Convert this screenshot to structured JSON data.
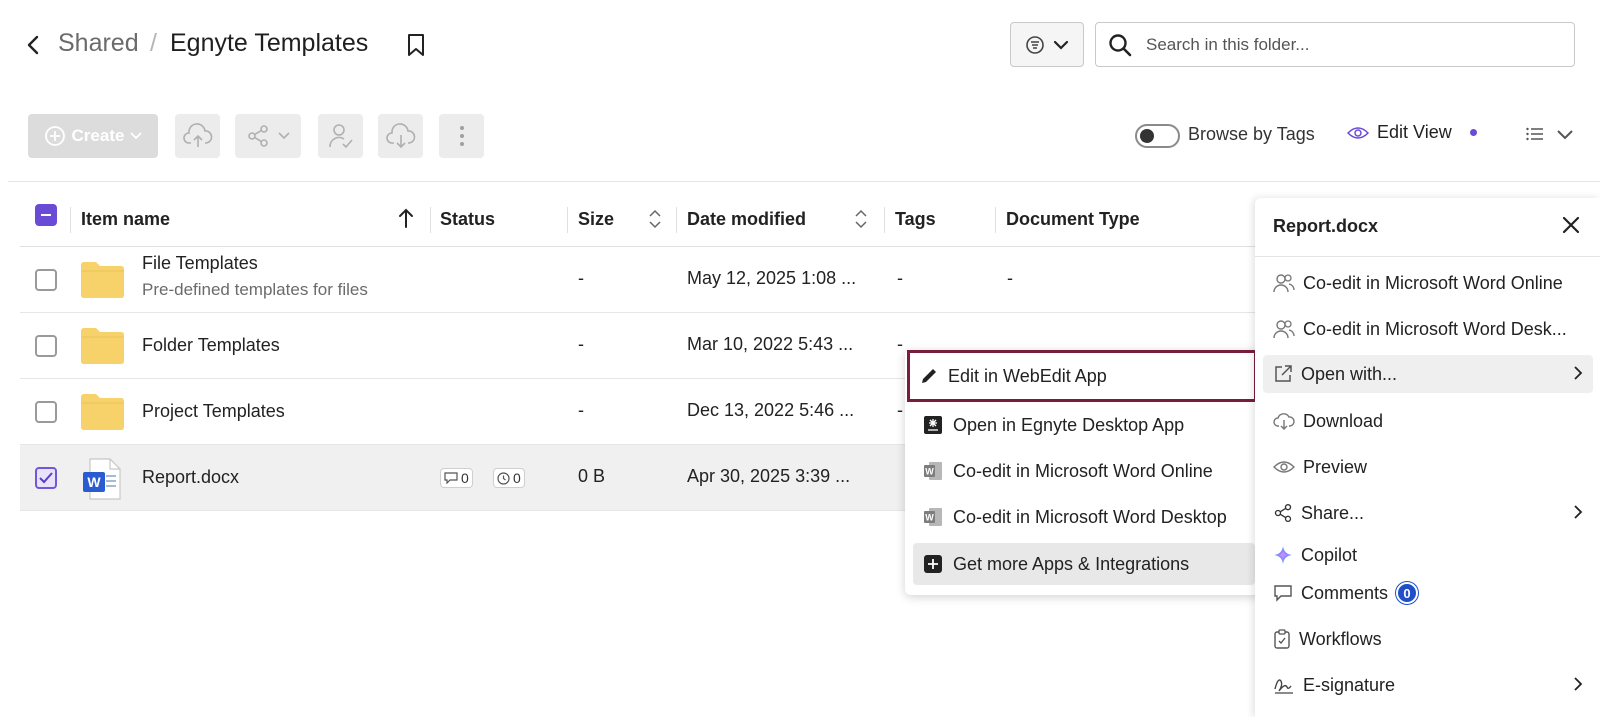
{
  "header": {
    "breadcrumb_parent": "Shared",
    "breadcrumb_separator": "/",
    "title": "Egnyte Templates",
    "search_placeholder": "Search in this folder..."
  },
  "toolbar": {
    "create_label": "Create",
    "browse_by_tags_label": "Browse by Tags",
    "edit_view_label": "Edit View"
  },
  "table": {
    "columns": [
      "Item name",
      "Status",
      "Size",
      "Date modified",
      "Tags",
      "Document Type"
    ],
    "rows": [
      {
        "name": "File Templates",
        "subtitle": "Pre-defined templates for files",
        "size": "-",
        "date": "May 12, 2025 1:08 ...",
        "tags": "-",
        "doctype": "-",
        "selected": false
      },
      {
        "name": "Folder Templates",
        "size": "-",
        "date": "Mar 10, 2022 5:43 ...",
        "tags": "-",
        "doctype": "-",
        "selected": false
      },
      {
        "name": "Project Templates",
        "size": "-",
        "date": "Dec 13, 2022 5:46 ...",
        "tags": "-",
        "doctype": "-",
        "selected": false
      },
      {
        "name": "Report.docx",
        "comments_count": "0",
        "versions_count": "0",
        "size": "0 B",
        "date": "Apr 30, 2025 3:39 ...",
        "selected": true
      }
    ]
  },
  "context_menu": {
    "items": [
      "Edit in WebEdit App",
      "Open in Egnyte Desktop App",
      "Co-edit in Microsoft Word Online",
      "Co-edit in Microsoft Word Desktop",
      "Get more Apps & Integrations"
    ]
  },
  "panel": {
    "title": "Report.docx",
    "items": [
      "Co-edit in Microsoft Word Online",
      "Co-edit in Microsoft Word Desk...",
      "Open with...",
      "Download",
      "Preview",
      "Share...",
      "Copilot",
      "Comments",
      "Workflows",
      "E-signature"
    ],
    "comments_badge": "0"
  },
  "colors": {
    "accent_purple": "#6a4bd6",
    "focus_border": "#7a1d3c",
    "badge_blue": "#1f4fc9",
    "folder_yellow": "#f7d26b"
  }
}
